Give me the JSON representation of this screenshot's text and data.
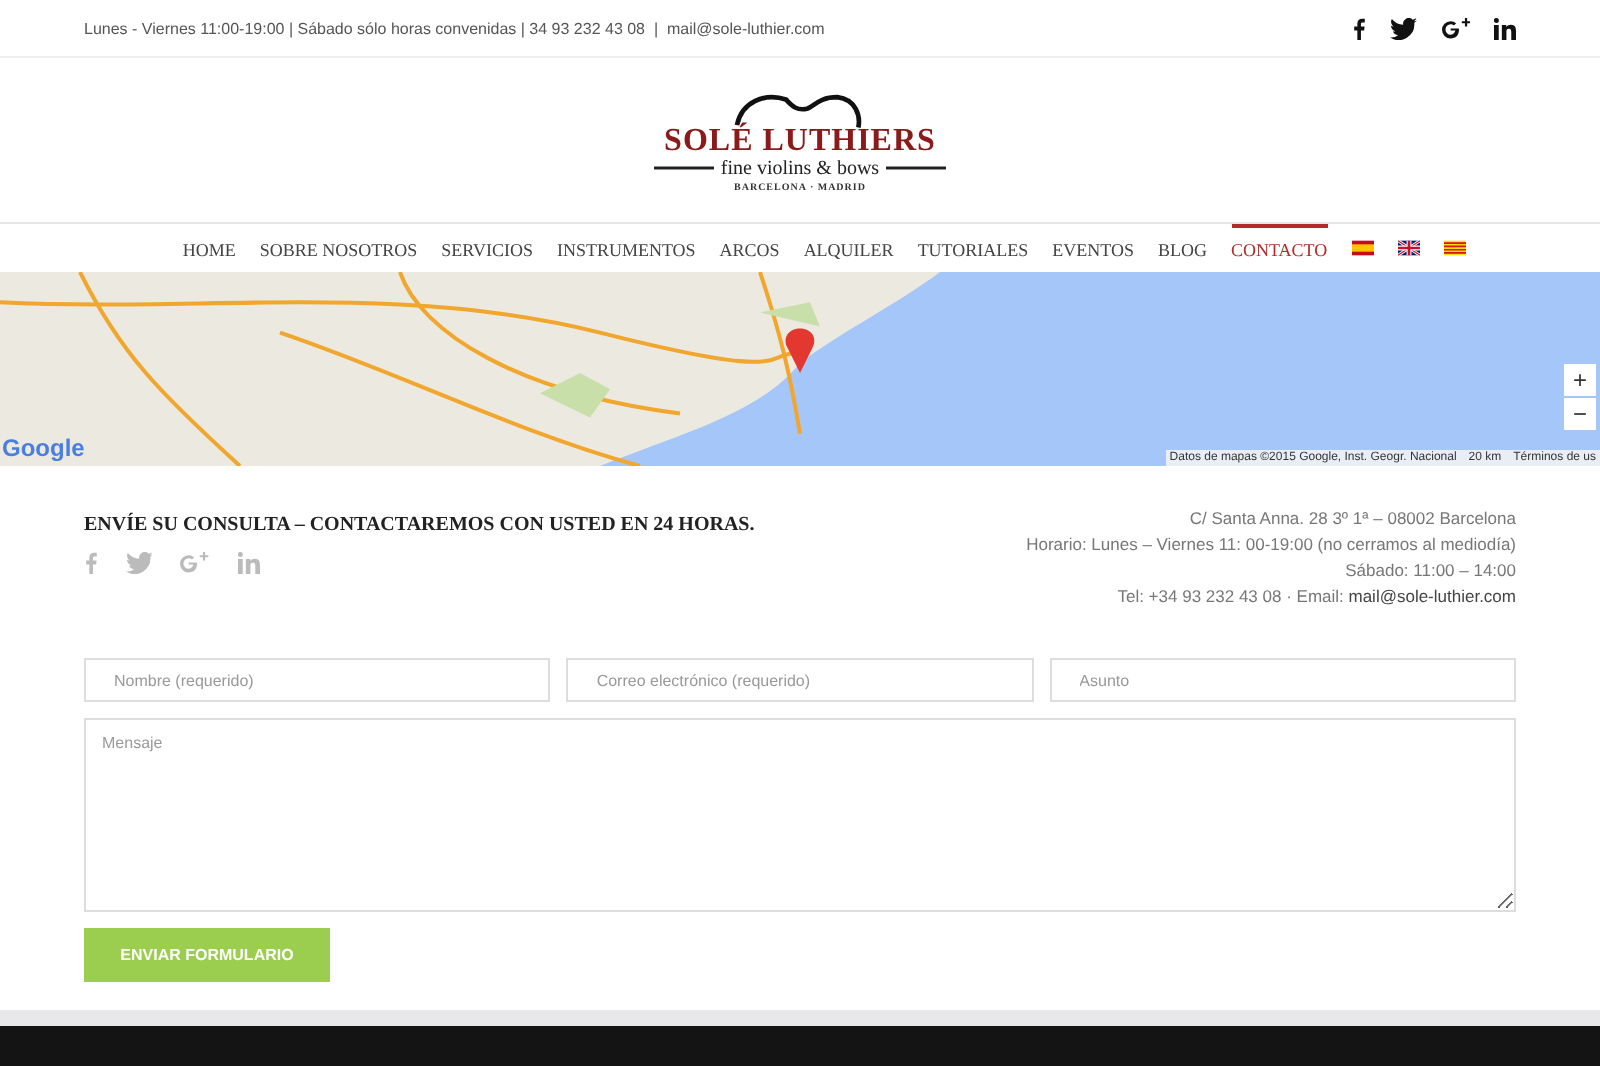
{
  "top_bar": {
    "info": "Lunes - Viernes 11:00-19:00 | Sábado sólo horas convenidas | 34 93 232 43 08  |  mail@sole-luthier.com",
    "social": [
      {
        "kind": "facebook"
      },
      {
        "kind": "twitter"
      },
      {
        "kind": "googleplus"
      },
      {
        "kind": "linkedin"
      }
    ]
  },
  "logo": {
    "name": "SOLÉ LUTHIERS",
    "tagline": "fine violins & bows",
    "cities": "BARCELONA · MADRID"
  },
  "nav": {
    "items": [
      {
        "label": "HOME",
        "selected": false
      },
      {
        "label": "SOBRE NOSOTROS",
        "selected": false
      },
      {
        "label": "SERVICIOS",
        "selected": false
      },
      {
        "label": "INSTRUMENTOS",
        "selected": false
      },
      {
        "label": "ARCOS",
        "selected": false
      },
      {
        "label": "ALQUILER",
        "selected": false
      },
      {
        "label": "TUTORIALES",
        "selected": false
      },
      {
        "label": "EVENTOS",
        "selected": false
      },
      {
        "label": "BLOG",
        "selected": false
      },
      {
        "label": "CONTACTO",
        "selected": true
      }
    ],
    "flags": [
      {
        "kind": "es"
      },
      {
        "kind": "gb"
      },
      {
        "kind": "cat"
      }
    ]
  },
  "map": {
    "logo": "Google",
    "attribution": "Datos de mapas ©2015 Google, Inst. Geogr. Nacional",
    "scale": "20 km",
    "terms": "Términos de us",
    "zoom_in": "+",
    "zoom_out": "−"
  },
  "contact": {
    "heading": "ENVÍE SU CONSULTA – CONTACTAREMOS CON USTED EN 24 HORAS.",
    "social": [
      {
        "kind": "facebook"
      },
      {
        "kind": "twitter"
      },
      {
        "kind": "googleplus"
      },
      {
        "kind": "linkedin"
      }
    ],
    "address": [
      "C/ Santa Anna. 28 3º 1ª – 08002 Barcelona",
      "Horario: Lunes – Viernes 11: 00-19:00 (no cerramos al mediodía)",
      "Sábado: 11:00 – 14:00"
    ],
    "phone_email": "Tel: +34 93 232 43 08 · Email: ",
    "email": "mail@sole-luthier.com"
  },
  "form": {
    "fields": [
      {
        "placeholder": "Nombre (requerido)"
      },
      {
        "placeholder": "Correo electrónico (requerido)"
      },
      {
        "placeholder": "Asunto"
      }
    ],
    "message": {
      "placeholder": "Mensaje"
    },
    "submit": "ENVIAR FORMULARIO"
  }
}
